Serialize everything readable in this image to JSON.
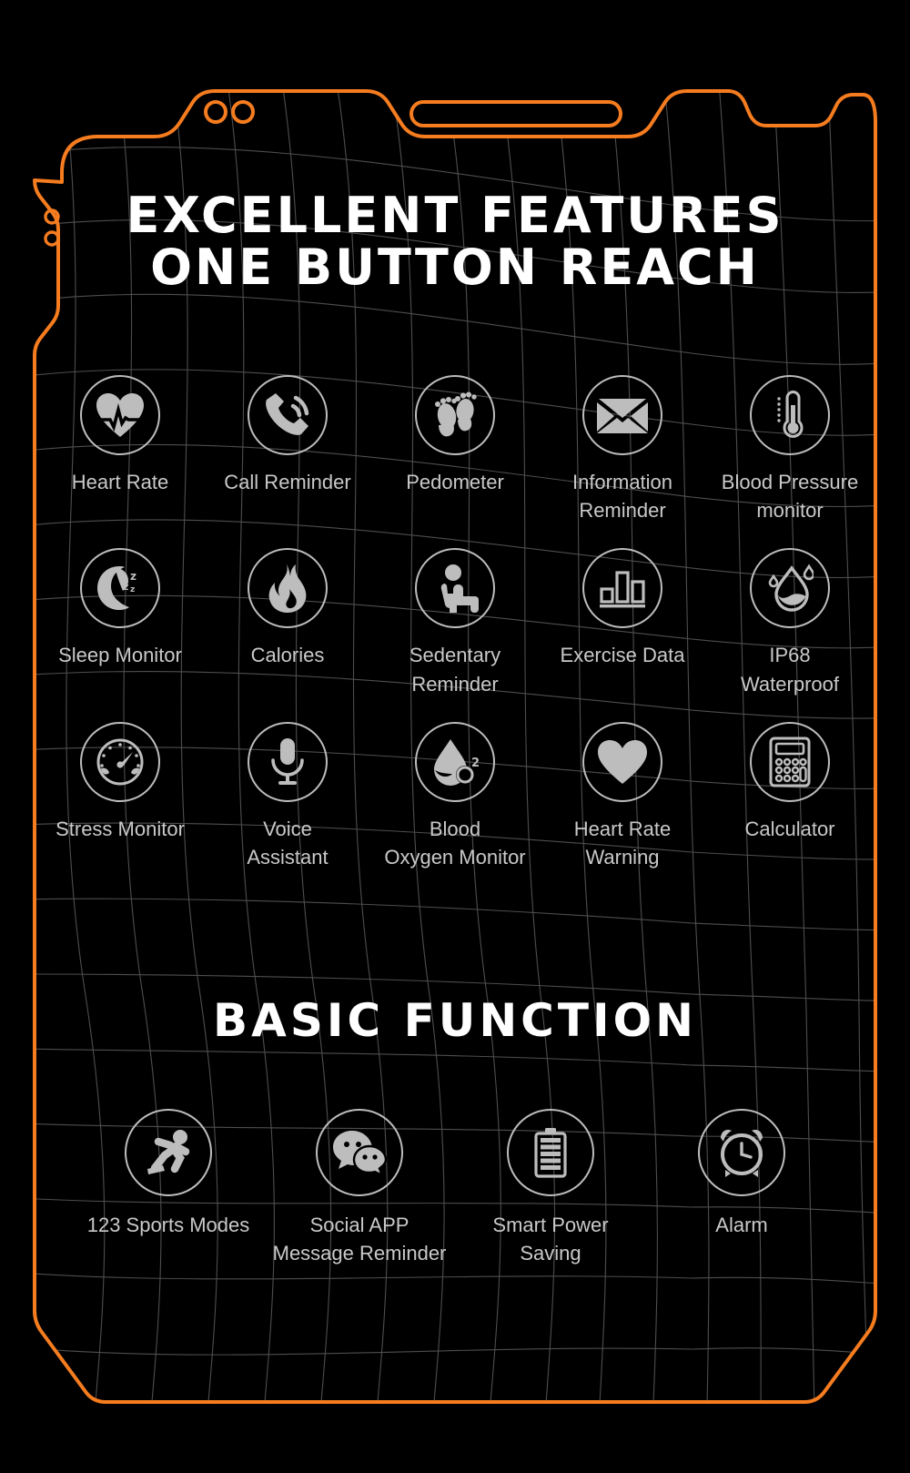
{
  "theme": {
    "background": "#000000",
    "accent_orange": "#F57C1F",
    "icon_gray": "#bdbdbd",
    "label_gray": "#c9c9c9",
    "title_white": "#ffffff",
    "mesh_line": "#5a5a5a"
  },
  "headline": {
    "line1": "EXCELLENT FEATURES",
    "line2": "ONE BUTTON REACH"
  },
  "section_title": "BASIC FUNCTION",
  "features": [
    {
      "label": "Heart Rate",
      "icon": "heart-pulse-icon"
    },
    {
      "label": "Call Reminder",
      "icon": "phone-ringing-icon"
    },
    {
      "label": "Pedometer",
      "icon": "footprints-icon"
    },
    {
      "label": "Information\nReminder",
      "icon": "envelope-icon"
    },
    {
      "label": "Blood Pressure\nmonitor",
      "icon": "thermometer-icon"
    },
    {
      "label": "Sleep Monitor",
      "icon": "moon-zzz-icon"
    },
    {
      "label": "Calories",
      "icon": "flame-icon"
    },
    {
      "label": "Sedentary\nReminder",
      "icon": "seated-person-icon"
    },
    {
      "label": "Exercise Data",
      "icon": "bar-chart-icon"
    },
    {
      "label": "IP68\nWaterproof",
      "icon": "water-drop-icon"
    },
    {
      "label": "Stress Monitor",
      "icon": "gauge-icon"
    },
    {
      "label": "Voice\nAssistant",
      "icon": "microphone-icon"
    },
    {
      "label": "Blood\nOxygen Monitor",
      "icon": "blood-oxygen-icon"
    },
    {
      "label": "Heart Rate\nWarning",
      "icon": "heart-solid-icon"
    },
    {
      "label": "Calculator",
      "icon": "calculator-icon"
    }
  ],
  "basic_functions": [
    {
      "label": "123 Sports Modes",
      "icon": "running-person-icon"
    },
    {
      "label": "Social APP\nMessage Reminder",
      "icon": "chat-bubbles-icon"
    },
    {
      "label": "Smart Power\nSaving",
      "icon": "battery-icon"
    },
    {
      "label": "Alarm",
      "icon": "alarm-clock-icon"
    }
  ]
}
